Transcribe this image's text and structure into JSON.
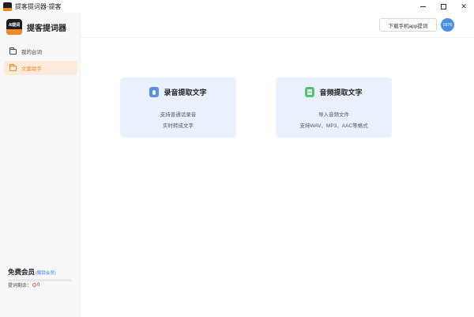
{
  "window": {
    "title": "提客提词器-提客"
  },
  "sidebar": {
    "brand_name": "提客提词器",
    "logo_text": "AI提词",
    "nav": [
      {
        "label": "我的台词",
        "icon": "folder-icon",
        "active": false
      },
      {
        "label": "文案助手",
        "icon": "folder-icon",
        "active": true
      }
    ],
    "member": {
      "title": "免费会员",
      "link": "(解锁会员)",
      "quota_label": "提词剩余：",
      "quota_value": "0",
      "quota_fraction": 0.0
    }
  },
  "header": {
    "download_label": "下载手机app提词",
    "avatar_text": "1976"
  },
  "cards": [
    {
      "title": "录音提取文字",
      "icon": "microphone-icon",
      "desc1": "支持普通话录音",
      "desc2": "实时转成文字"
    },
    {
      "title": "音频提取文字",
      "icon": "audio-file-icon",
      "desc1": "导入音频文件",
      "desc2": "支持WAV、MP3、AAC等格式"
    }
  ],
  "colors": {
    "accent": "#f08a24",
    "card_bg": "#e8f1fd",
    "link": "#3b7ff0",
    "avatar": "#4a90e2"
  }
}
